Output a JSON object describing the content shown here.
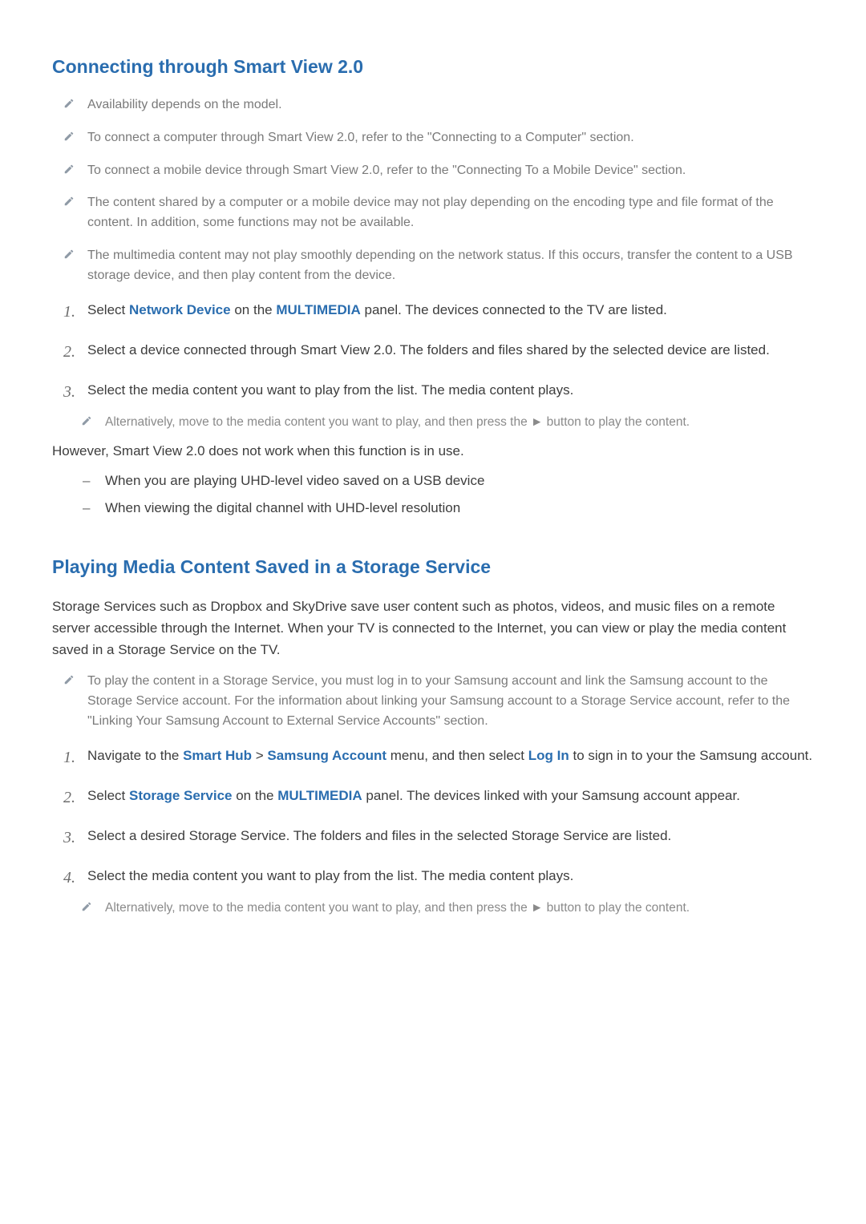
{
  "s1": {
    "title": "Connecting through Smart View 2.0",
    "notes": [
      "Availability depends on the model.",
      "To connect a computer through Smart View 2.0, refer to the \"Connecting to a Computer\" section.",
      "To connect a mobile device through Smart View 2.0, refer to the \"Connecting To a Mobile Device\" section.",
      "The content shared by a computer or a mobile device may not play depending on the encoding type and file format of the content. In addition, some functions may not be available.",
      "The multimedia content may not play smoothly depending on the network status. If this occurs, transfer the content to a USB storage device, and then play content from the device."
    ],
    "step1": {
      "pre": "Select ",
      "kw1": "Network Device",
      "mid": " on the ",
      "kw2": "MULTIMEDIA",
      "post": " panel. The devices connected to the TV are listed."
    },
    "step2": "Select a device connected through Smart View 2.0. The folders and files shared by the selected device are listed.",
    "step3": "Select the media content you want to play from the list. The media content plays.",
    "step3_sub": "Alternatively, move to the media content you want to play, and then press the ► button to play the content.",
    "however": "However, Smart View 2.0 does not work when this function is in use.",
    "dashes": [
      "When you are playing UHD-level video saved on a USB device",
      "When viewing the digital channel with UHD-level resolution"
    ]
  },
  "s2": {
    "title": "Playing Media Content Saved in a Storage Service",
    "intro": "Storage Services such as Dropbox and SkyDrive save user content such as photos, videos, and music files on a remote server accessible through the Internet. When your TV is connected to the Internet, you can view or play the media content saved in a Storage Service on the TV.",
    "note": "To play the content in a Storage Service, you must log in to your Samsung account and link the Samsung account to the Storage Service account. For the information about linking your Samsung account to a Storage Service account, refer to the \"Linking Your Samsung Account to External Service Accounts\" section.",
    "step1": {
      "pre": "Navigate to the ",
      "kw1": "Smart Hub",
      "sep": " > ",
      "kw2": "Samsung Account",
      "mid": " menu, and then select ",
      "kw3": "Log In",
      "post": " to sign in to your the Samsung account."
    },
    "step2": {
      "pre": "Select ",
      "kw1": "Storage Service",
      "mid": " on the ",
      "kw2": "MULTIMEDIA",
      "post": " panel. The devices linked with your Samsung account appear."
    },
    "step3": "Select a desired Storage Service. The folders and files in the selected Storage Service are listed.",
    "step4": "Select the media content you want to play from the list. The media content plays.",
    "step4_sub": "Alternatively, move to the media content you want to play, and then press the ► button to play the content."
  },
  "nums": {
    "n1": "1.",
    "n2": "2.",
    "n3": "3.",
    "n4": "4."
  },
  "dash_mark": "–"
}
